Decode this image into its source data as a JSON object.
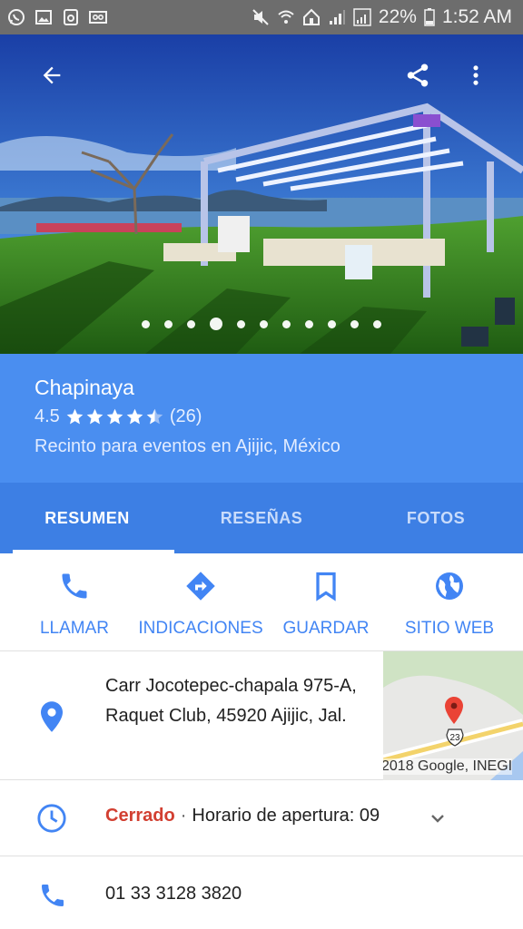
{
  "status_bar": {
    "battery": "22%",
    "time": "1:52 AM"
  },
  "hero": {
    "photo_count": 11,
    "active_photo_index": 3
  },
  "place": {
    "name": "Chapinaya",
    "rating": "4.5",
    "rating_value": 4.5,
    "review_count": "(26)",
    "category": "Recinto para eventos en Ajijic, México"
  },
  "tabs": [
    {
      "label": "RESUMEN",
      "active": true
    },
    {
      "label": "RESEÑAS",
      "active": false
    },
    {
      "label": "FOTOS",
      "active": false
    }
  ],
  "actions": {
    "call": "LLAMAR",
    "directions": "INDICACIONES",
    "save": "GUARDAR",
    "website": "SITIO WEB"
  },
  "address": {
    "text": "Carr Jocotepec-chapala 975-A, Raquet Club, 45920 Ajijic, Jal.",
    "map_attribution": "2018 Google, INEGI",
    "road_shield": "23"
  },
  "hours": {
    "status": "Cerrado",
    "separator": "·",
    "detail": "Horario de apertura: 09"
  },
  "phone": {
    "number": "01 33 3128 3820"
  },
  "colors": {
    "header_blue": "#4a8ef0",
    "tab_blue": "#3d7fe4",
    "accent": "#4285f4",
    "closed_red": "#d23f31"
  },
  "icons": [
    "whatsapp-icon",
    "image-icon",
    "recycle-icon",
    "voicemail-icon",
    "mute-icon",
    "wifi-icon",
    "home-icon",
    "signal-icon",
    "battery-icon",
    "back-arrow-icon",
    "share-icon",
    "more-vert-icon",
    "phone-icon",
    "directions-icon",
    "bookmark-icon",
    "globe-icon",
    "location-pin-icon",
    "clock-icon",
    "chevron-down-icon"
  ]
}
